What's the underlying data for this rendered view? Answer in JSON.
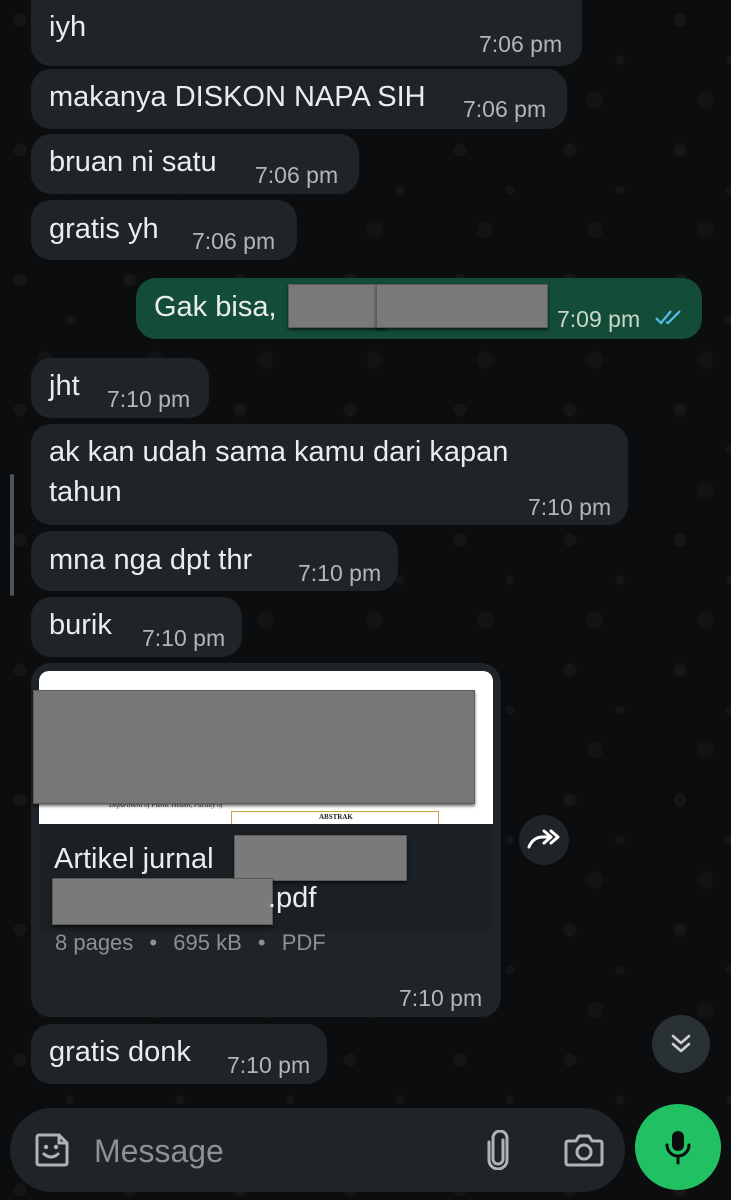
{
  "messages": [
    {
      "direction": "in",
      "text": "iyh",
      "time": "7:06 pm"
    },
    {
      "direction": "in",
      "text": "makanya DISKON NAPA SIH",
      "time": "7:06 pm"
    },
    {
      "direction": "in",
      "text": "bruan ni satu",
      "time": "7:06 pm"
    },
    {
      "direction": "in",
      "text": "gratis yh",
      "time": "7:06 pm"
    },
    {
      "direction": "out",
      "text": "Gak bisa,",
      "time": "7:09 pm",
      "status": "read"
    },
    {
      "direction": "in",
      "text": "jht",
      "time": "7:10 pm"
    },
    {
      "direction": "in",
      "text_line1": "ak kan udah sama kamu dari kapan",
      "text_line2": "tahun",
      "time": "7:10 pm"
    },
    {
      "direction": "in",
      "text": "mna nga dpt thr",
      "time": "7:10 pm"
    },
    {
      "direction": "in",
      "text": "burik",
      "time": "7:10 pm"
    },
    {
      "direction": "in",
      "type": "document",
      "preview_left": "Department of Public Health, Faculty of",
      "preview_right": "ABSTRAK",
      "name_prefix": "Artikel jurnal",
      "name_suffix": ".pdf",
      "pages": "8 pages",
      "size": "695 kB",
      "filetype": "PDF",
      "separator": "•",
      "time": "7:10 pm"
    },
    {
      "direction": "in",
      "text": "gratis donk",
      "time": "7:10 pm"
    }
  ],
  "composer": {
    "placeholder": "Message"
  },
  "icons": {
    "sticker": "sticker-icon",
    "attach": "paperclip-icon",
    "camera": "camera-icon",
    "mic": "microphone-icon",
    "forward": "forward-icon",
    "scroll": "double-chevron-down-icon",
    "read": "double-check-icon"
  },
  "colors": {
    "accent": "#21c063",
    "outgoing_bubble": "#144d37",
    "incoming_bubble": "#1e2427",
    "read_ticks": "#53bdeb"
  }
}
